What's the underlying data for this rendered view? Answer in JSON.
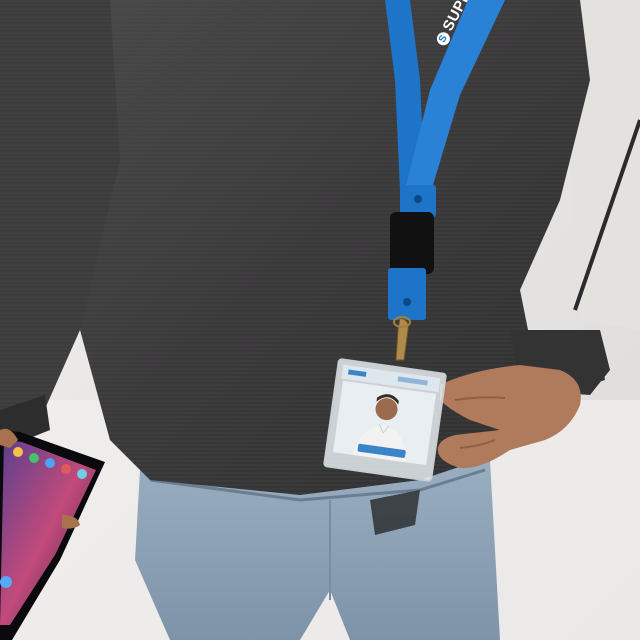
{
  "lanyard": {
    "brand_text": "SUPERSPRING"
  },
  "colors": {
    "background_wall": "#ecebea",
    "sweater": "#3b3a3b",
    "lanyard_blue": "#1e74c8",
    "jeans": "#8ea3b8",
    "phone_screen": "#3b2f6b"
  }
}
